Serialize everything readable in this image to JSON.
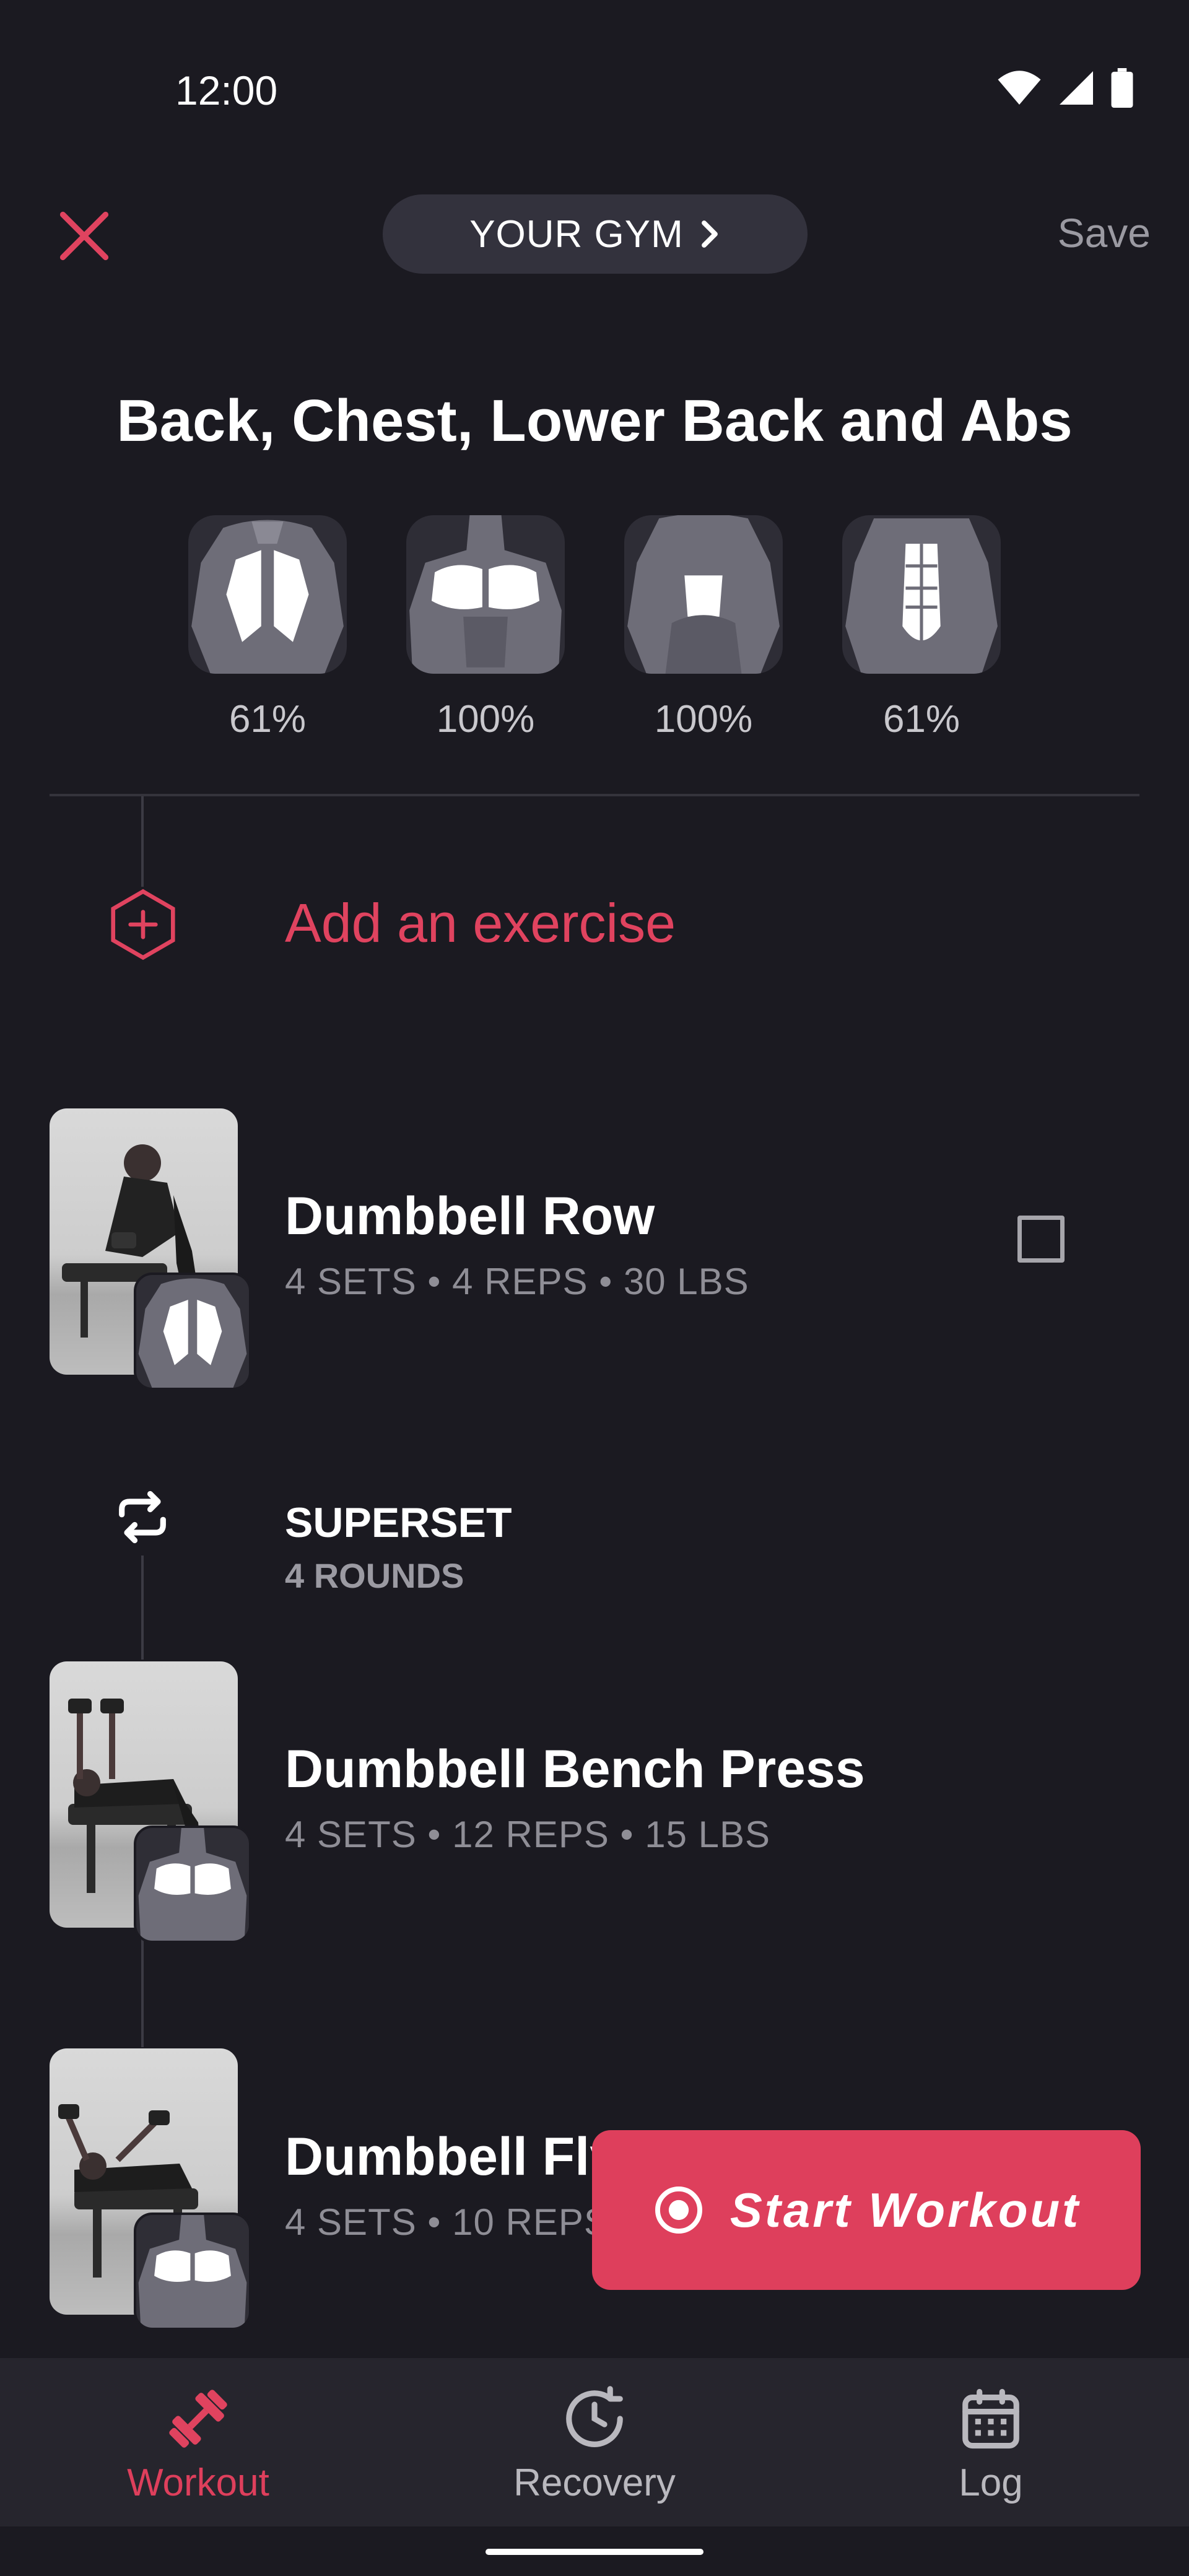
{
  "status_bar": {
    "time": "12:00"
  },
  "header": {
    "gym_label": "YOUR GYM",
    "save_label": "Save"
  },
  "workout": {
    "title": "Back, Chest, Lower Back and Abs",
    "muscles": [
      {
        "name": "Back",
        "percent": "61%"
      },
      {
        "name": "Chest",
        "percent": "100%"
      },
      {
        "name": "Lower Back",
        "percent": "100%"
      },
      {
        "name": "Abs",
        "percent": "61%"
      }
    ]
  },
  "add_exercise_label": "Add an exercise",
  "exercises": [
    {
      "name": "Dumbbell Row",
      "detail": "4 SETS • 4 REPS • 30 LBS"
    },
    {
      "name": "Dumbbell Bench Press",
      "detail": "4 SETS • 12 REPS • 15 LBS"
    },
    {
      "name": "Dumbbell Fly",
      "detail": "4 SETS • 10 REPS • 15 LBS"
    }
  ],
  "superset": {
    "label": "SUPERSET",
    "rounds": "4 ROUNDS"
  },
  "start_button_label": "Start Workout",
  "bottom_nav": [
    {
      "label": "Workout",
      "icon": "dumbbell-icon",
      "active": true
    },
    {
      "label": "Recovery",
      "icon": "recovery-clock-icon",
      "active": false
    },
    {
      "label": "Log",
      "icon": "calendar-icon",
      "active": false
    }
  ],
  "colors": {
    "background": "#1b1a21",
    "accent": "#de3f5c",
    "muted_text": "#8f8e96",
    "nav_background": "#26252d"
  }
}
